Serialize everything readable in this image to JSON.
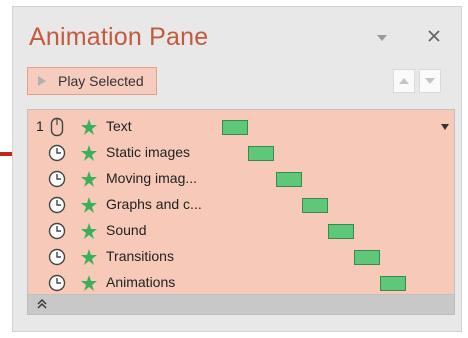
{
  "pane": {
    "title": "Animation Pane",
    "play_label": "Play Selected",
    "icons": {
      "dropdown": "chevron-down-icon",
      "close": "close-icon",
      "play": "play-triangle-icon",
      "move_up": "move-up-icon",
      "move_down": "move-down-icon",
      "collapse": "double-chevron-up-icon"
    }
  },
  "animations": [
    {
      "number": "1",
      "start": "on-click",
      "name": "Text"
    },
    {
      "number": "",
      "start": "after-previous",
      "name": "Static images"
    },
    {
      "number": "",
      "start": "after-previous",
      "name": "Moving imag..."
    },
    {
      "number": "",
      "start": "after-previous",
      "name": "Graphs and c..."
    },
    {
      "number": "",
      "start": "after-previous",
      "name": "Sound"
    },
    {
      "number": "",
      "start": "after-previous",
      "name": "Transitions"
    },
    {
      "number": "",
      "start": "after-previous",
      "name": "Animations"
    }
  ],
  "colors": {
    "title": "#c55a3c",
    "list_background": "#f7c9b8",
    "timeline_bar": "#5ec77a",
    "arrow": "#c0281a"
  }
}
